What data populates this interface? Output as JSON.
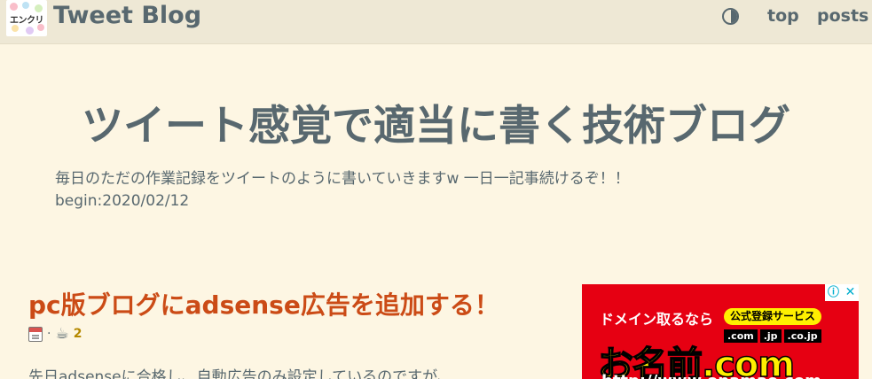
{
  "header": {
    "logo_text": "エンクリ",
    "site_title": "Tweet Blog",
    "theme_toggle_icon": "half-circle-contrast-icon",
    "nav": [
      {
        "label": "top"
      },
      {
        "label": "posts"
      }
    ]
  },
  "hero": {
    "title": "ツイート感覚で適当に書く技術ブログ",
    "description_line1": "毎日のただの作業記録をツイートのように書いていきますw 一日一記事続けるぞ！！",
    "description_line2": "begin:2020/02/12"
  },
  "post": {
    "title": "pc版ブログにadsense広告を追加する！",
    "meta_separator": "·",
    "reading_time": "2",
    "excerpt": "先日adsenseに合格し、自動広告のみ設定しているのですが、"
  },
  "ad": {
    "info_icon": "ⓘ",
    "close_icon": "✕",
    "line1": "ドメイン取るなら",
    "badge": "公式登録サービス",
    "domains": [
      ".com",
      ".jp",
      ".co.jp"
    ],
    "brand": "お名前.com",
    "url": "http://www.onamae.com"
  },
  "colors": {
    "background": "#fdf6e3",
    "header_bg": "#eee8d5",
    "text": "#58686f",
    "accent": "#cb4b16",
    "ad_red": "#e60012",
    "ad_yellow": "#ffef00"
  }
}
